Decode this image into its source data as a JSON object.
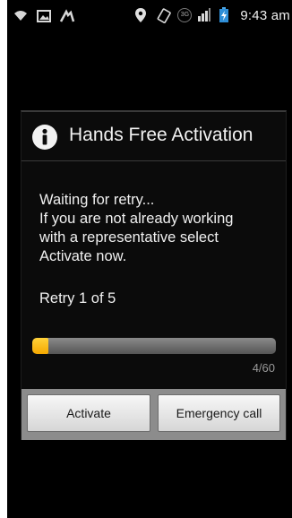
{
  "status_bar": {
    "time": "9:43 am",
    "left_icons": [
      "signal-wave-icon",
      "image-icon",
      "signal-boost-icon"
    ],
    "right_icons": [
      "location-pin-icon",
      "rotate-icon",
      "network-3g-icon",
      "mobile-signal-icon",
      "battery-icon"
    ],
    "network_label": "3G"
  },
  "dialog": {
    "title": "Hands Free Activation",
    "icon": "info-icon",
    "message_lines": [
      "Waiting for retry...",
      "If you are not already working",
      "with a representative select",
      "Activate now."
    ],
    "retry_text": "Retry 1 of 5",
    "progress": {
      "current": 4,
      "max": 60,
      "label": "4/60",
      "fill_color": "#f5a800",
      "track_color": "#6e6e6e"
    },
    "buttons": {
      "activate": "Activate",
      "emergency": "Emergency call"
    }
  },
  "colors": {
    "background": "#000000",
    "text": "#f0f0f0",
    "accent": "#f5a800"
  }
}
